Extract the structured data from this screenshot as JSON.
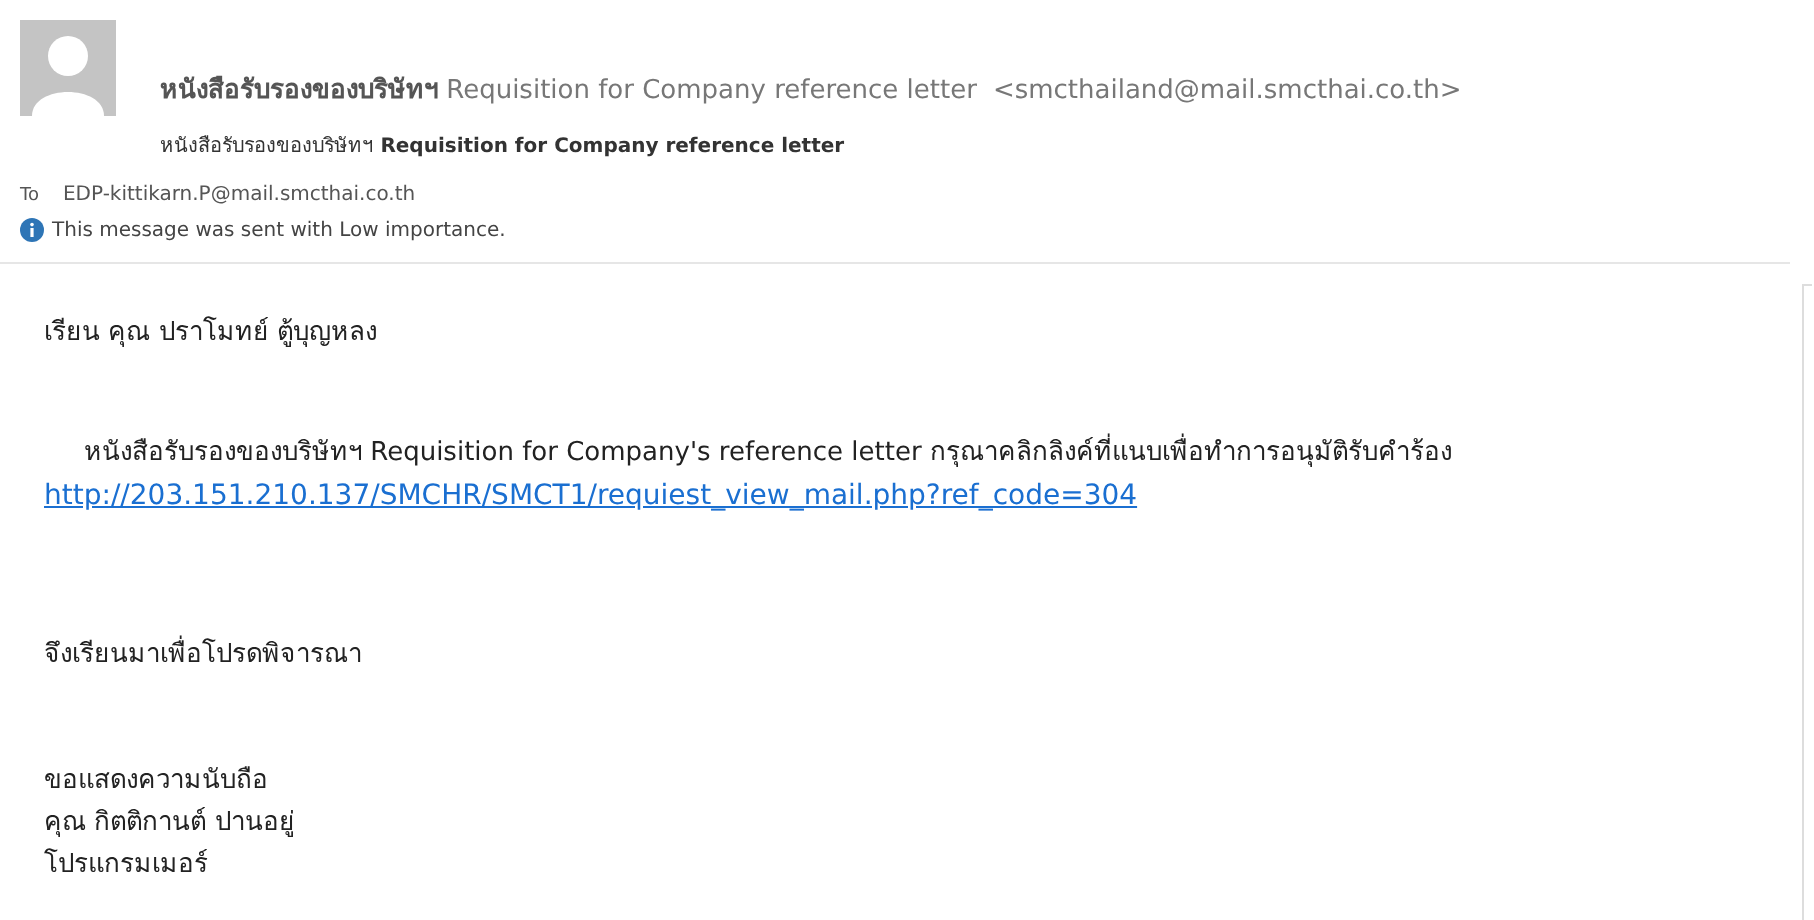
{
  "header": {
    "sender_name": "**หนังสือรับรองของบริษัทฯ** Requisition for Company reference letter",
    "sender_email": "<smcthailand@mail.smcthai.co.th>",
    "subject": "หนังสือรับรองของบริษัทฯ **Requisition for Company reference letter**",
    "to_label": "To",
    "to_address": "EDP-kittikarn.P@mail.smcthai.co.th",
    "notice": "This message was sent with Low importance."
  },
  "body": {
    "greeting": "เรียน คุณ ปราโมทย์ ตู้บุญหลง",
    "paragraph": "หนังสือรับรองของบริษัทฯ Requisition for Company's reference letter กรุณาคลิกลิงค์ที่แนบเพื่อทำการอนุมัติรับคำร้อง",
    "link": "http://203.151.210.137/SMCHR/SMCT1/requiest_view_mail.php?ref_code=304",
    "closing": "จึงเรียนมาเพื่อโปรดพิจารณา",
    "signature": [
      "ขอแสดงความนับถือ",
      "คุณ กิตติกานต์ ปานอยู่",
      "โปรแกรมเมอร์"
    ]
  }
}
